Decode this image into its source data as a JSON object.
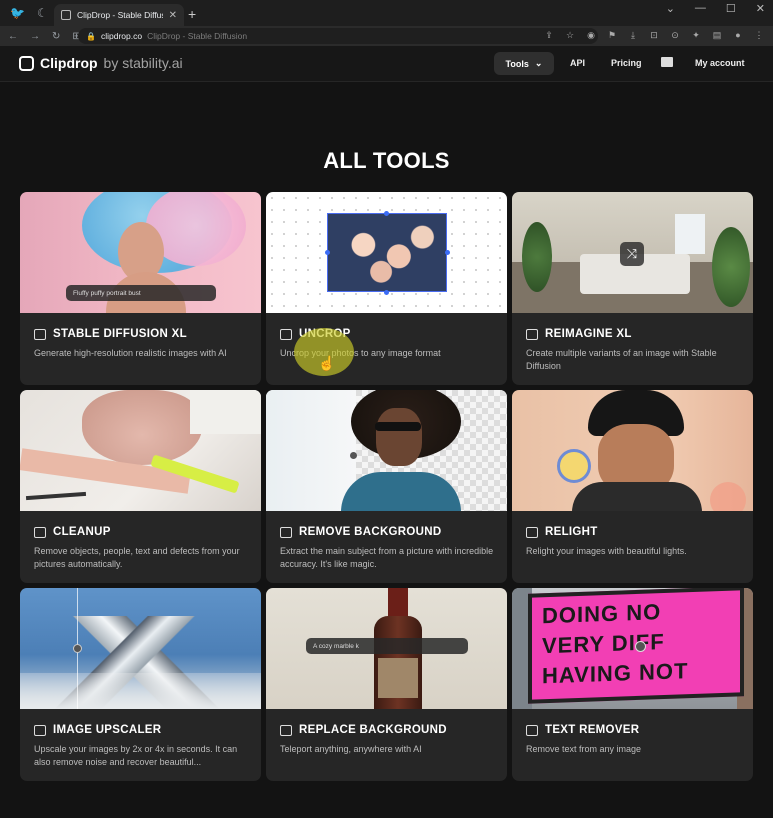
{
  "browser": {
    "tab_title": "ClipDrop - Stable Diffusion",
    "url_host": "clipdrop.co",
    "url_rest": "ClipDrop - Stable Diffusion"
  },
  "header": {
    "brand": "Clipdrop",
    "brand_by": "by stability.ai",
    "nav": {
      "tools": "Tools",
      "api": "API",
      "pricing": "Pricing",
      "account": "My account"
    }
  },
  "main": {
    "title": "ALL TOOLS",
    "cards": [
      {
        "title": "STABLE DIFFUSION XL",
        "desc": "Generate high-resolution realistic images with AI",
        "overlay": "Fluffy puffy portrait bust"
      },
      {
        "title": "UNCROP",
        "desc": "Uncrop your photos to any image format"
      },
      {
        "title": "REIMAGINE XL",
        "desc": "Create multiple variants of an image with Stable Diffusion"
      },
      {
        "title": "CLEANUP",
        "desc": "Remove objects, people, text and defects from your pictures automatically."
      },
      {
        "title": "REMOVE BACKGROUND",
        "desc": "Extract the main subject from a picture with incredible accuracy. It's like magic."
      },
      {
        "title": "RELIGHT",
        "desc": "Relight your images with beautiful lights."
      },
      {
        "title": "IMAGE UPSCALER",
        "desc": "Upscale your images by 2x or 4x in seconds. It can also remove noise and recover beautiful..."
      },
      {
        "title": "REPLACE BACKGROUND",
        "desc": "Teleport anything, anywhere with AI",
        "overlay": "A cozy marble k"
      },
      {
        "title": "TEXT REMOVER",
        "desc": "Remove text from any image",
        "billboard": [
          "DOING NO",
          "VERY DIFF",
          "HAVING NOT"
        ]
      }
    ]
  }
}
